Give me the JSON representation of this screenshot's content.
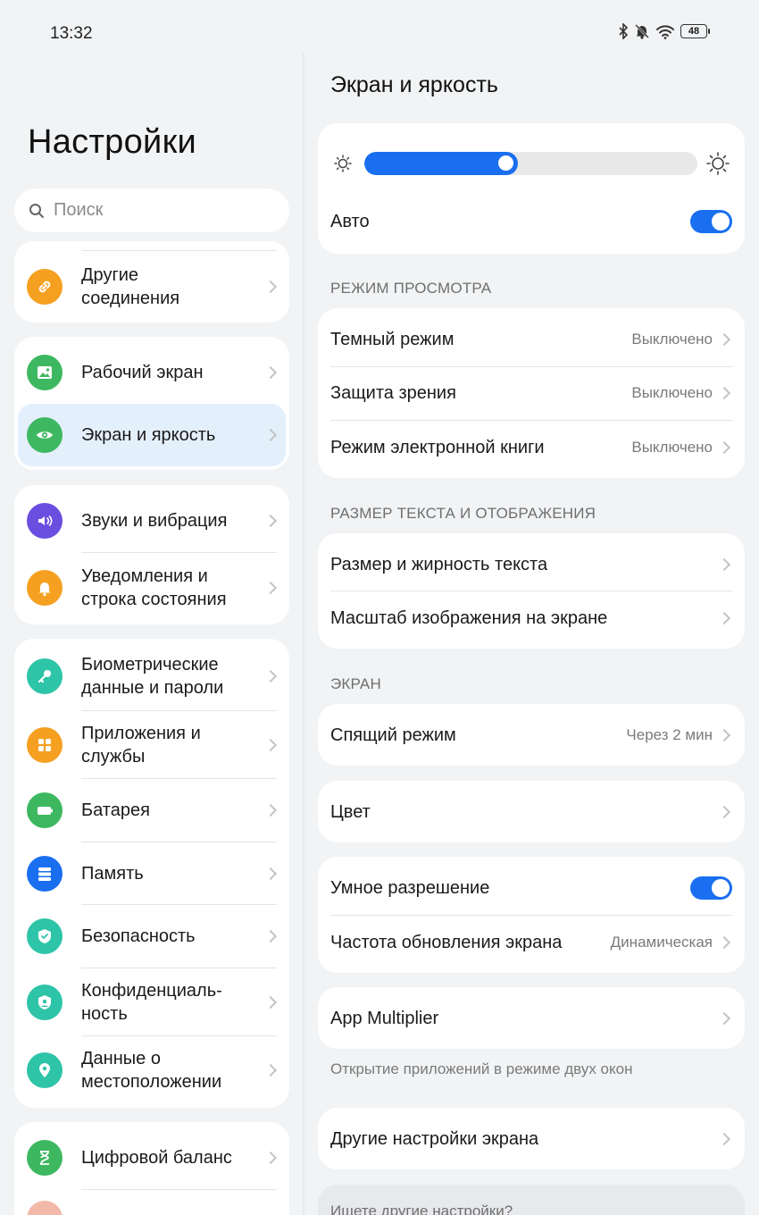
{
  "status": {
    "time": "13:32",
    "battery": "48"
  },
  "left": {
    "title": "Настройки",
    "search_placeholder": "Поиск",
    "items": [
      {
        "label": "Другие соединения",
        "icon": "link-icon",
        "color": "#f5a020"
      },
      {
        "label": "Рабочий экран",
        "icon": "image-icon",
        "color": "#3db860"
      },
      {
        "label": "Экран и яркость",
        "icon": "eye-icon",
        "color": "#3db860",
        "selected": true
      },
      {
        "label": "Звуки и вибрация",
        "icon": "speaker-icon",
        "color": "#6a4ee0"
      },
      {
        "label": "Уведомления и строка состояния",
        "icon": "bell-icon",
        "color": "#f5a020"
      },
      {
        "label": "Биометрические данные и пароли",
        "icon": "key-icon",
        "color": "#2ec4a8"
      },
      {
        "label": "Приложения и службы",
        "icon": "apps-icon",
        "color": "#f5a020"
      },
      {
        "label": "Батарея",
        "icon": "battery-icon",
        "color": "#3db860"
      },
      {
        "label": "Память",
        "icon": "storage-icon",
        "color": "#1a6ff0"
      },
      {
        "label": "Безопасность",
        "icon": "shield-icon",
        "color": "#2ec4a8"
      },
      {
        "label": "Конфиденциаль-ность",
        "icon": "privacy-icon",
        "color": "#2ec4a8"
      },
      {
        "label": "Данные о местоположении",
        "icon": "location-icon",
        "color": "#2ec4a8"
      },
      {
        "label": "Цифровой баланс",
        "icon": "hourglass-icon",
        "color": "#3db860"
      }
    ]
  },
  "right": {
    "title": "Экран и яркость",
    "brightness": {
      "level": 0.46,
      "auto_label": "Авто",
      "auto_on": true
    },
    "sections": {
      "view_mode": "РЕЖИМ ПРОСМОТРА",
      "text_size": "РАЗМЕР ТЕКСТА И ОТОБРАЖЕНИЯ",
      "screen": "ЭКРАН"
    },
    "view_mode_items": [
      {
        "label": "Темный режим",
        "value": "Выключено"
      },
      {
        "label": "Защита зрения",
        "value": "Выключено"
      },
      {
        "label": "Режим электронной книги",
        "value": "Выключено"
      }
    ],
    "text_items": [
      {
        "label": "Размер и жирность текста"
      },
      {
        "label": "Масштаб изображения на экране"
      }
    ],
    "sleep": {
      "label": "Спящий режим",
      "value": "Через 2 мин"
    },
    "color": {
      "label": "Цвет"
    },
    "smart_resolution": {
      "label": "Умное разрешение",
      "on": true
    },
    "refresh_rate": {
      "label": "Частота обновления экрана",
      "value": "Динамическая"
    },
    "app_multiplier": {
      "label": "App Multiplier",
      "note": "Открытие приложений в режиме двух окон"
    },
    "other_settings": {
      "label": "Другие настройки экрана"
    },
    "search_more": "Ищете другие настройки?"
  }
}
